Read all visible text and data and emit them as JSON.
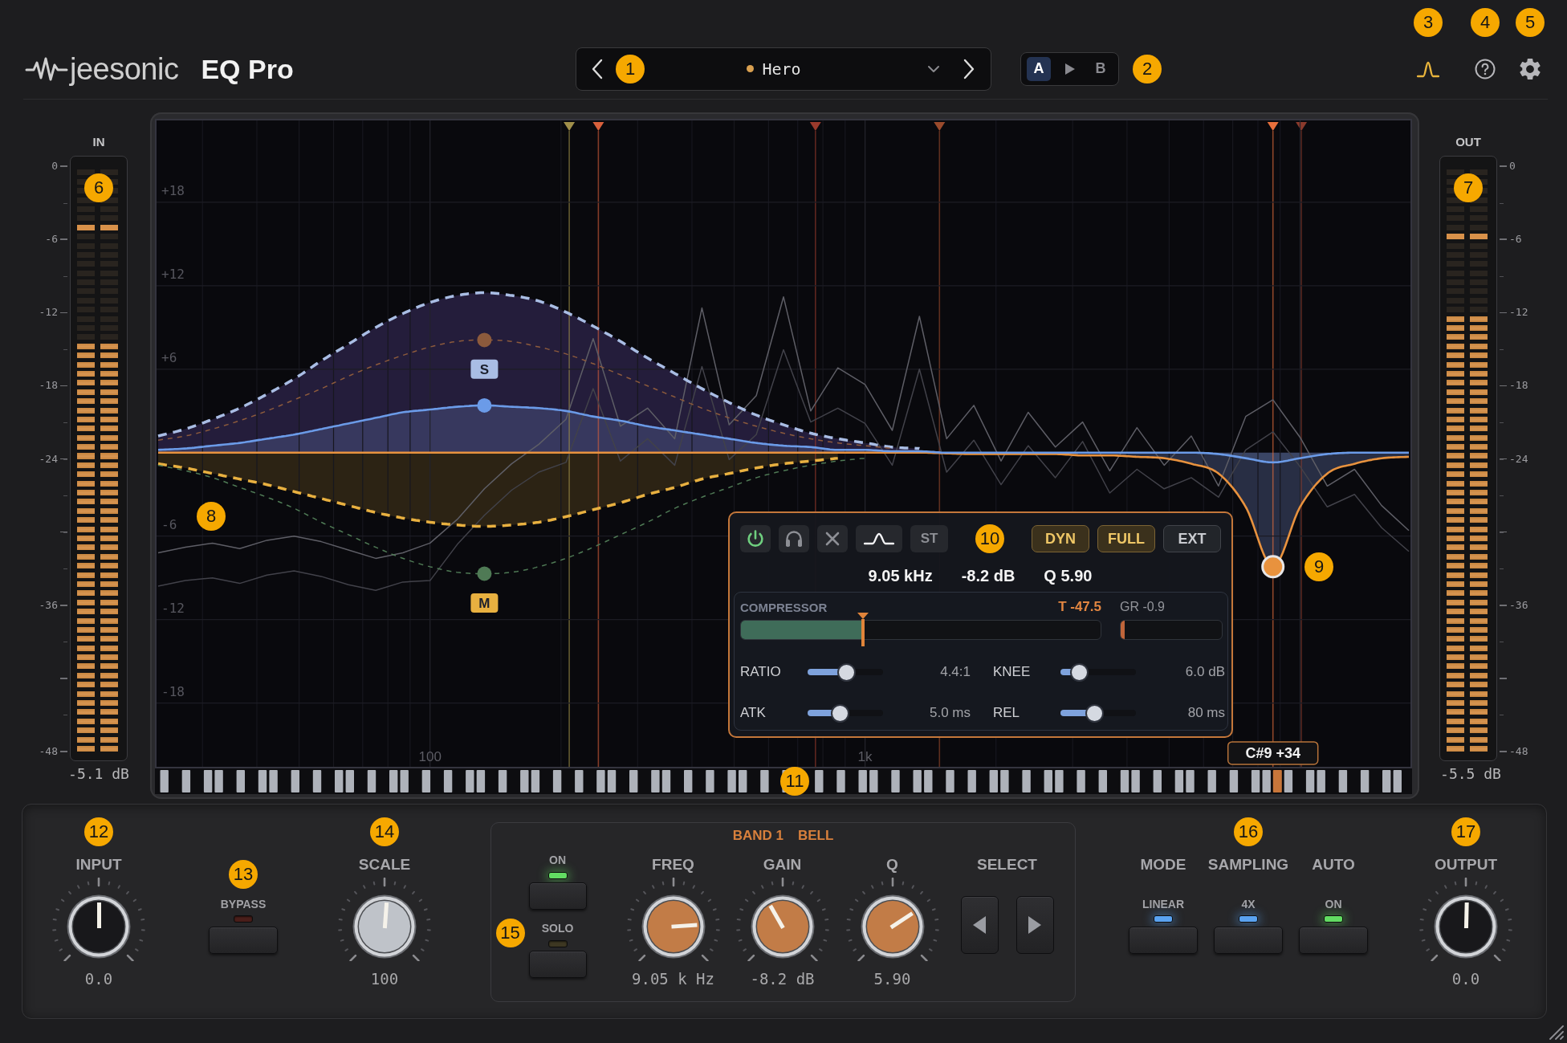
{
  "header": {
    "brand": "jeesonic",
    "product": "EQ Pro",
    "preset": {
      "name": "Hero",
      "modified": true,
      "callout": "1"
    },
    "ab": {
      "items": [
        {
          "label": "A",
          "selected": true
        },
        {
          "label": "B",
          "selected": false
        }
      ],
      "callout": "2"
    },
    "tools": [
      {
        "kind": "analyzer",
        "on": true,
        "callout": "3"
      },
      {
        "kind": "help",
        "on": false,
        "callout": "4"
      },
      {
        "kind": "settings",
        "on": false,
        "callout": "5"
      }
    ]
  },
  "input_meter": {
    "label": "IN",
    "readout": "-5.1 dB",
    "callout": "6",
    "scale": [
      {
        "kind": "labeled",
        "label": "0"
      },
      {
        "kind": "labeled",
        "label": "-6"
      },
      {
        "kind": "labeled",
        "label": "-12"
      },
      {
        "kind": "labeled",
        "label": "-18"
      },
      {
        "kind": "labeled",
        "label": "-24"
      },
      {
        "kind": "tick"
      },
      {
        "kind": "labeled",
        "label": "-36"
      },
      {
        "kind": "tick"
      },
      {
        "kind": "labeled",
        "label": "-48"
      }
    ],
    "channels": [
      {
        "level": 0.7,
        "peak": {
          "level": 0.9
        }
      },
      {
        "level": 0.7,
        "peak": {
          "level": 0.9
        }
      }
    ]
  },
  "graph": {
    "chart_data": {
      "type": "line",
      "grid": true,
      "ylim": [
        -22.7,
        24
      ],
      "categories": [
        null,
        null,
        null,
        null,
        null,
        null,
        null,
        null,
        null,
        null,
        "100",
        null,
        null,
        null,
        null,
        null,
        null,
        null,
        null,
        null,
        null,
        null,
        null,
        null,
        null,
        null,
        "1k",
        null,
        null,
        null,
        null,
        null,
        null,
        null,
        null,
        null,
        null,
        null,
        null,
        null,
        null,
        null,
        null,
        null,
        null,
        null,
        null
      ],
      "yticks": [
        {
          "value": 18,
          "label": "+18"
        },
        {
          "value": 12,
          "label": "+12"
        },
        {
          "value": 6,
          "label": "+6"
        },
        {
          "value": -6,
          "label": "-6"
        },
        {
          "value": -12,
          "label": "-12"
        },
        {
          "value": -18,
          "label": "-18"
        }
      ],
      "series": [
        {
          "color": "#5e5e66",
          "line_style": "solid",
          "values": [
            -7.2,
            -6.8,
            -6.5,
            -6.9,
            -6.3,
            -6.0,
            -6.4,
            -7.0,
            -7.6,
            -7.2,
            -6.5,
            -4.8,
            -2.6,
            -0.8,
            0.6,
            2.4,
            8.2,
            1.9,
            3.2,
            1.0,
            10.4,
            2.0,
            4.1,
            11.2,
            3.0,
            6.1,
            4.9,
            1.6,
            9.8,
            1.0,
            3.4,
            -0.6,
            2.9,
            0.4,
            2.2,
            -1.3,
            1.8,
            -0.9,
            1.2,
            -2.4,
            2.6,
            3.8,
            1.1,
            -2.4,
            -1.2,
            -3.8,
            -5.6
          ]
        },
        {
          "color": "#42424a",
          "line_style": "solid",
          "values": [
            -9.6,
            -9.2,
            -9.0,
            -9.4,
            -8.8,
            -8.5,
            -8.9,
            -9.5,
            -9.9,
            -9.3,
            -9.2,
            -6.6,
            -4.5,
            -2.7,
            -1.4,
            -0.7,
            4.6,
            -0.6,
            1.0,
            -0.9,
            6.2,
            -0.5,
            1.3,
            7.4,
            2.2,
            3.2,
            2.1,
            -0.9,
            6.0,
            -1.4,
            0.9,
            -2.3,
            0.5,
            -1.8,
            0.8,
            -2.9,
            -1.2,
            -2.6,
            -1.8,
            -3.2,
            0.2,
            1.5,
            -1.0,
            -3.9,
            -3.0,
            -5.4,
            -7.1
          ]
        },
        {
          "color": "#e8923e",
          "line_style": "solid",
          "values": [
            0,
            0,
            0,
            0,
            0,
            0,
            0,
            0,
            0,
            0,
            0,
            0,
            0,
            0,
            0,
            0,
            0,
            0,
            0,
            0,
            0,
            0,
            0,
            0,
            0,
            0,
            0,
            0,
            0,
            null,
            -0.1,
            -0.1,
            -0.1,
            -0.1,
            -0.2,
            -0.2,
            -0.3,
            -0.4,
            -0.8,
            -1.5,
            -3.9,
            -8.2,
            -3.9,
            -1.5,
            -0.8,
            -0.4,
            -0.3
          ]
        },
        {
          "color": "#a9bde4",
          "line_style": "dashed",
          "values": [
            1.2,
            1.7,
            2.4,
            3.2,
            4.2,
            5.3,
            6.6,
            7.8,
            9.0,
            10.0,
            10.8,
            11.3,
            11.5,
            11.3,
            10.9,
            10.1,
            9.1,
            8.0,
            6.8,
            5.7,
            4.6,
            3.6,
            2.7,
            2.0,
            1.4,
            1.0,
            0.7,
            0.4,
            0.3,
            null,
            null,
            null,
            null,
            null,
            null,
            null,
            null,
            null,
            null,
            null,
            null,
            null,
            null,
            null,
            null,
            null,
            null
          ]
        },
        {
          "color": "#8c5a3c",
          "line_style": "dotted",
          "values": [
            0.9,
            1.2,
            1.7,
            2.3,
            3.0,
            3.8,
            4.6,
            5.5,
            6.3,
            7.0,
            7.6,
            8.0,
            8.1,
            8.0,
            7.6,
            7.1,
            6.4,
            5.6,
            4.8,
            4.0,
            3.2,
            2.5,
            1.9,
            1.4,
            1.0,
            0.7,
            0.5,
            0.3,
            null,
            null,
            null,
            null,
            null,
            null,
            null,
            null,
            null,
            null,
            null,
            null,
            null,
            null,
            null,
            null,
            null,
            null,
            null
          ]
        },
        {
          "color": "#e8b040",
          "line_style": "dashed",
          "values": [
            -0.8,
            -1.1,
            -1.5,
            -1.9,
            -2.3,
            -2.8,
            -3.3,
            -3.8,
            -4.3,
            -4.7,
            -5.0,
            -5.2,
            -5.3,
            -5.2,
            -5.0,
            -4.6,
            -4.1,
            -3.6,
            -3.0,
            -2.5,
            -1.9,
            -1.5,
            -1.1,
            -0.8,
            -0.6,
            -0.4,
            null,
            null,
            null,
            null,
            null,
            null,
            null,
            null,
            null,
            null,
            null,
            null,
            null,
            null,
            null,
            null,
            null,
            null,
            null,
            null,
            null
          ]
        },
        {
          "color": "#4f7a55",
          "line_style": "dotted",
          "values": [
            -0.9,
            -1.3,
            -1.8,
            -2.5,
            -3.2,
            -4.0,
            -5.0,
            -5.9,
            -6.8,
            -7.6,
            -8.2,
            -8.6,
            -8.7,
            -8.6,
            -8.2,
            -7.6,
            -6.8,
            -5.9,
            -5.0,
            -4.0,
            -3.2,
            -2.5,
            -1.8,
            -1.3,
            -0.9,
            -0.6,
            -0.4,
            null,
            null,
            null,
            null,
            null,
            null,
            null,
            null,
            null,
            null,
            null,
            null,
            null,
            null,
            null,
            null,
            null,
            null,
            null,
            null
          ]
        },
        {
          "color": "#6b9be8",
          "line_style": "solid",
          "values": [
            0.2,
            0.3,
            0.5,
            0.7,
            1.0,
            1.3,
            1.7,
            2.1,
            2.5,
            2.9,
            3.1,
            3.3,
            3.4,
            3.3,
            3.2,
            3.0,
            2.6,
            2.3,
            1.9,
            1.6,
            1.3,
            1.0,
            0.7,
            0.5,
            0.4,
            0.2,
            0.2,
            0.1,
            0.1,
            0,
            0,
            0,
            0,
            0,
            0,
            0,
            0,
            0,
            0,
            -0.1,
            -0.4,
            -0.7,
            -0.4,
            -0.1,
            0,
            0,
            0
          ]
        }
      ],
      "annotations": [
        "S",
        "M",
        "C#9 +34"
      ]
    },
    "callouts": [
      {
        "label": "8"
      },
      {
        "label": "9"
      }
    ],
    "band_panel": {
      "callout": "10",
      "buttons": [
        {
          "kind": "power",
          "on": true
        },
        {
          "kind": "listen",
          "on": false
        },
        {
          "kind": "delete",
          "on": false
        },
        {
          "kind": "shape",
          "on": true
        },
        {
          "kind": "text",
          "label": "ST",
          "on": false
        }
      ],
      "modes": [
        {
          "label": "DYN",
          "on": true
        },
        {
          "label": "FULL",
          "on": true
        },
        {
          "label": "EXT",
          "on": false
        }
      ],
      "readouts": [
        "9.05 kHz",
        "-8.2 dB",
        "Q 5.90"
      ],
      "compressor": {
        "title": "COMPRESSOR",
        "threshold": "T -47.5",
        "gain_reduction": "GR -0.9",
        "threshold_meter": {
          "level": 0.34
        },
        "gr_meter": {
          "level": 0.04
        },
        "params": [
          {
            "label": "RATIO",
            "value": "4.4:1",
            "level": 0.52
          },
          {
            "label": "KNEE",
            "value": "6.0 dB",
            "level": 0.25
          },
          {
            "label": "ATK",
            "value": "5.0 ms",
            "level": 0.43
          },
          {
            "label": "REL",
            "value": "80 ms",
            "level": 0.45
          }
        ]
      }
    },
    "keyboard": {
      "callout": "11"
    }
  },
  "output_meter": {
    "label": "OUT",
    "readout": "-5.5 dB",
    "callout": "7",
    "scale": [
      {
        "kind": "labeled",
        "label": "0"
      },
      {
        "kind": "labeled",
        "label": "-6"
      },
      {
        "kind": "labeled",
        "label": "-12"
      },
      {
        "kind": "labeled",
        "label": "-18"
      },
      {
        "kind": "labeled",
        "label": "-24"
      },
      {
        "kind": "tick"
      },
      {
        "kind": "labeled",
        "label": "-36"
      },
      {
        "kind": "tick"
      },
      {
        "kind": "labeled",
        "label": "-48"
      }
    ],
    "channels": [
      {
        "level": 0.75,
        "peak": {
          "level": 0.886
        }
      },
      {
        "level": 0.75,
        "peak": {
          "level": 0.886
        }
      }
    ]
  },
  "controls": {
    "input": {
      "label": "INPUT",
      "value": "0.0",
      "level": 0.5,
      "kind": "dark",
      "callout": "12"
    },
    "bypass": {
      "label": "BYPASS",
      "on": false,
      "color": "#4a1e1a",
      "callout": "13"
    },
    "scale": {
      "label": "SCALE",
      "value": "100",
      "level": 0.515,
      "kind": "silver",
      "callout": "14"
    },
    "band": {
      "title": "BAND 1",
      "shape": "BELL",
      "callout": "15",
      "switches": [
        {
          "label": "ON",
          "on": true,
          "color": "#62dc62"
        },
        {
          "label": "SOLO",
          "on": false,
          "color": "#3d3722"
        }
      ],
      "knobs": [
        {
          "label": "FREQ",
          "value": "9.05 k Hz",
          "level": 0.82,
          "kind": "copper"
        },
        {
          "label": "GAIN",
          "value": "-8.2 dB",
          "level": 0.39,
          "kind": "copper"
        },
        {
          "label": "Q",
          "value": "5.90",
          "level": 0.71,
          "kind": "copper"
        }
      ],
      "select": {
        "label": "SELECT"
      }
    },
    "options": {
      "callout": "16",
      "items": [
        {
          "label": "MODE",
          "setting": "LINEAR",
          "on": true,
          "color": "#5aa2f0"
        },
        {
          "label": "SAMPLING",
          "setting": "4X",
          "on": true,
          "color": "#5aa2f0"
        },
        {
          "label": "AUTO",
          "setting": "ON",
          "on": true,
          "color": "#62dc62"
        }
      ]
    },
    "output": {
      "label": "OUTPUT",
      "value": "0.0",
      "level": 0.505,
      "kind": "dark",
      "callout": "17"
    }
  }
}
